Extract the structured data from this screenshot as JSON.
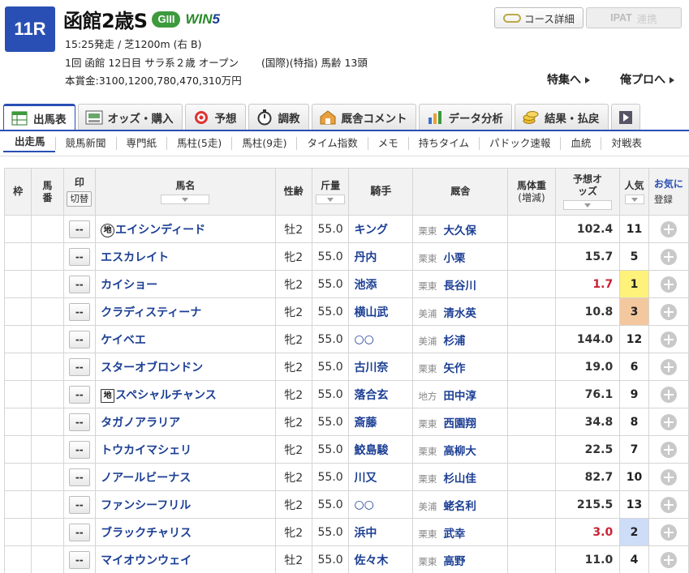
{
  "race": {
    "number": "11R",
    "name": "函館2歳S",
    "grade": "GIII",
    "win5_a": "WIN",
    "win5_b": "5",
    "line1": "15:25発走 / 芝1200m (右 B)",
    "line2a": "1回 函館 12日目 サラ系２歳 オープン",
    "line2b": "(国際)(特指) 馬齢 13頭",
    "line3": "本賞金:3100,1200,780,470,310万円"
  },
  "buttons": {
    "course": "コース詳細",
    "ipat": "IPAT",
    "ipat_link": "連携",
    "feature": "特集へ",
    "pro": "俺プロへ"
  },
  "tabs": [
    "出馬表",
    "オッズ・購入",
    "予想",
    "調教",
    "厩舎コメント",
    "データ分析",
    "結果・払戻"
  ],
  "subtabs": [
    "出走馬",
    "競馬新聞",
    "専門紙",
    "馬柱(5走)",
    "馬柱(9走)",
    "タイム指数",
    "メモ",
    "持ちタイム",
    "パドック速報",
    "血統",
    "対戦表"
  ],
  "headers": {
    "waku": "枠",
    "umaban": "馬番",
    "mark": "印",
    "switch": "切替",
    "name": "馬名",
    "sex": "性齢",
    "weight": "斤量",
    "jockey": "騎手",
    "stable": "厩舎",
    "body": "馬体重",
    "body_sub": "(増減)",
    "odds": "予想オッズ",
    "pop": "人気",
    "fav": "お気に",
    "reg": "登録"
  },
  "colors": {
    "accent": "#2a4fb4",
    "pop1": "#fff27a",
    "pop2": "#cddcf7",
    "pop3": "#f4c89f"
  },
  "horses": [
    {
      "mark": "--",
      "badge": "地",
      "name": "エイシンディード",
      "sex": "牡2",
      "weight": "55.0",
      "jockey": "キング",
      "area": "栗東",
      "trainer": "大久保",
      "odds": "102.4",
      "pop": "11"
    },
    {
      "mark": "--",
      "badge": "",
      "name": "エスカレイト",
      "sex": "牝2",
      "weight": "55.0",
      "jockey": "丹内",
      "area": "栗東",
      "trainer": "小栗",
      "odds": "15.7",
      "pop": "5"
    },
    {
      "mark": "--",
      "badge": "",
      "name": "カイショー",
      "sex": "牝2",
      "weight": "55.0",
      "jockey": "池添",
      "area": "栗東",
      "trainer": "長谷川",
      "odds": "1.7",
      "pop": "1"
    },
    {
      "mark": "--",
      "badge": "",
      "name": "クラディスティーナ",
      "sex": "牝2",
      "weight": "55.0",
      "jockey": "横山武",
      "area": "美浦",
      "trainer": "清水英",
      "odds": "10.8",
      "pop": "3"
    },
    {
      "mark": "--",
      "badge": "",
      "name": "ケイベエ",
      "sex": "牝2",
      "weight": "55.0",
      "jockey": "○○",
      "area": "美浦",
      "trainer": "杉浦",
      "odds": "144.0",
      "pop": "12"
    },
    {
      "mark": "--",
      "badge": "",
      "name": "スターオブロンドン",
      "sex": "牝2",
      "weight": "55.0",
      "jockey": "古川奈",
      "area": "栗東",
      "trainer": "矢作",
      "odds": "19.0",
      "pop": "6"
    },
    {
      "mark": "--",
      "badge": "地sq",
      "name": "スペシャルチャンス",
      "sex": "牝2",
      "weight": "55.0",
      "jockey": "落合玄",
      "area": "地方",
      "trainer": "田中淳",
      "odds": "76.1",
      "pop": "9"
    },
    {
      "mark": "--",
      "badge": "",
      "name": "タガノアラリア",
      "sex": "牝2",
      "weight": "55.0",
      "jockey": "斎藤",
      "area": "栗東",
      "trainer": "西園翔",
      "odds": "34.8",
      "pop": "8"
    },
    {
      "mark": "--",
      "badge": "",
      "name": "トウカイマシェリ",
      "sex": "牝2",
      "weight": "55.0",
      "jockey": "鮫島駿",
      "area": "栗東",
      "trainer": "高柳大",
      "odds": "22.5",
      "pop": "7"
    },
    {
      "mark": "--",
      "badge": "",
      "name": "ノアールビーナス",
      "sex": "牝2",
      "weight": "55.0",
      "jockey": "川又",
      "area": "栗東",
      "trainer": "杉山佳",
      "odds": "82.7",
      "pop": "10"
    },
    {
      "mark": "--",
      "badge": "",
      "name": "ファンシーフリル",
      "sex": "牝2",
      "weight": "55.0",
      "jockey": "○○",
      "area": "美浦",
      "trainer": "蛯名利",
      "odds": "215.5",
      "pop": "13"
    },
    {
      "mark": "--",
      "badge": "",
      "name": "ブラックチャリス",
      "sex": "牝2",
      "weight": "55.0",
      "jockey": "浜中",
      "area": "栗東",
      "trainer": "武幸",
      "odds": "3.0",
      "pop": "2"
    },
    {
      "mark": "--",
      "badge": "",
      "name": "マイオウンウェイ",
      "sex": "牡2",
      "weight": "55.0",
      "jockey": "佐々木",
      "area": "栗東",
      "trainer": "高野",
      "odds": "11.0",
      "pop": "4"
    }
  ]
}
